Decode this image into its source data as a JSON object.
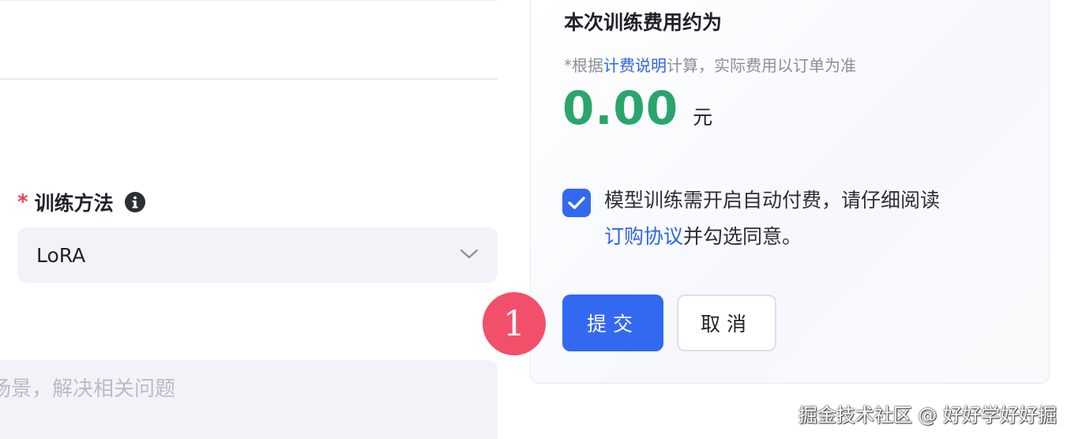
{
  "form": {
    "method": {
      "label": "训练方法",
      "required_mark": "*",
      "info_icon": "info-icon",
      "selected_value": "LoRA",
      "dropdown_icon": "chevron-down-icon"
    },
    "description": {
      "placeholder": "场景，解决相关问题"
    }
  },
  "cost_panel": {
    "title": "本次训练费用约为",
    "note_prefix": "*根据",
    "note_link": "计费说明",
    "note_suffix": "计算，实际费用以订单为准",
    "amount": "0.00",
    "unit": "元",
    "agreement": {
      "checked": true,
      "text_prefix": "模型训练需开启自动付费，请仔细阅读",
      "link": "订购协议",
      "text_suffix": "并勾选同意。"
    },
    "submit_label": "提交",
    "cancel_label": "取消"
  },
  "step_marker": "1",
  "watermark": "掘金技术社区 @ 好好学好好掘",
  "colors": {
    "primary": "#3368f0",
    "price_green": "#2aa56b",
    "required_red": "#f0424f",
    "marker_red": "#f2506a"
  }
}
